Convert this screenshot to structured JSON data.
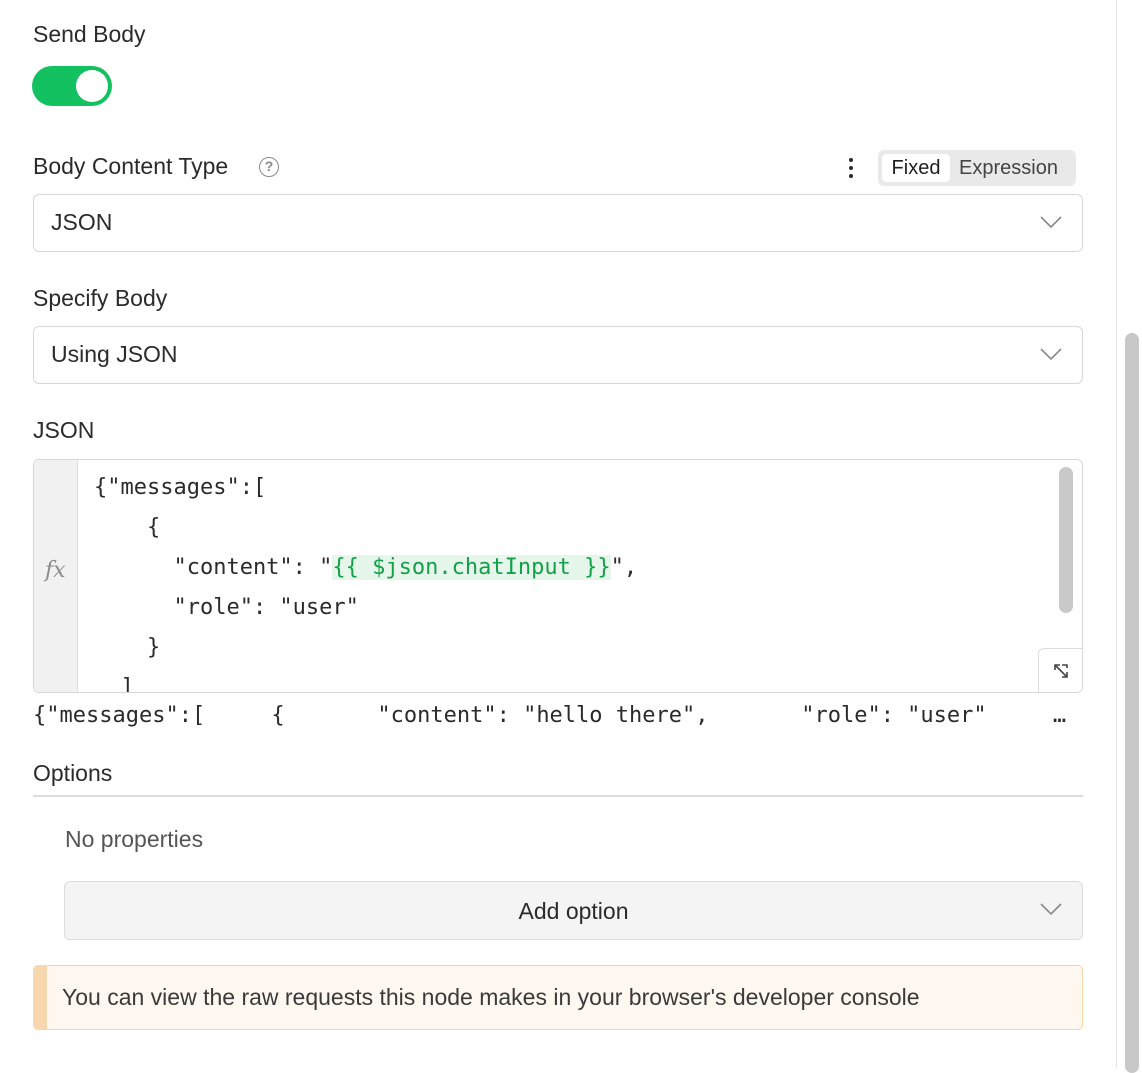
{
  "send_body": {
    "label": "Send Body",
    "enabled": true
  },
  "body_content_type": {
    "label": "Body Content Type",
    "help_icon": "question-circle-icon",
    "mode_options": [
      "Fixed",
      "Expression"
    ],
    "selected_mode": "Fixed",
    "value": "JSON"
  },
  "specify_body": {
    "label": "Specify Body",
    "value": "Using JSON"
  },
  "json_editor": {
    "label": "JSON",
    "gutter_symbol": "fx",
    "lines": [
      {
        "before": "{\"messages\":[",
        "expr": "",
        "after": ""
      },
      {
        "before": "    {",
        "expr": "",
        "after": ""
      },
      {
        "before": "      \"content\": \"",
        "expr": "{{ $json.chatInput }}",
        "after": "\","
      },
      {
        "before": "      \"role\": \"user\"",
        "expr": "",
        "after": ""
      },
      {
        "before": "    }",
        "expr": "",
        "after": ""
      },
      {
        "before": "  ]",
        "expr": "",
        "after": ""
      }
    ],
    "expression_color": "#14a04a",
    "preview": "{\"messages\":[     {       \"content\": \"hello there\",       \"role\": \"user\"       }     ]}"
  },
  "options": {
    "label": "Options",
    "empty_text": "No properties",
    "add_button_label": "Add option"
  },
  "notice": {
    "text": "You can view the raw requests this node makes in your browser's developer console"
  },
  "colors": {
    "toggle_on": "#13c160",
    "notice_accent": "#f7d8ae"
  }
}
